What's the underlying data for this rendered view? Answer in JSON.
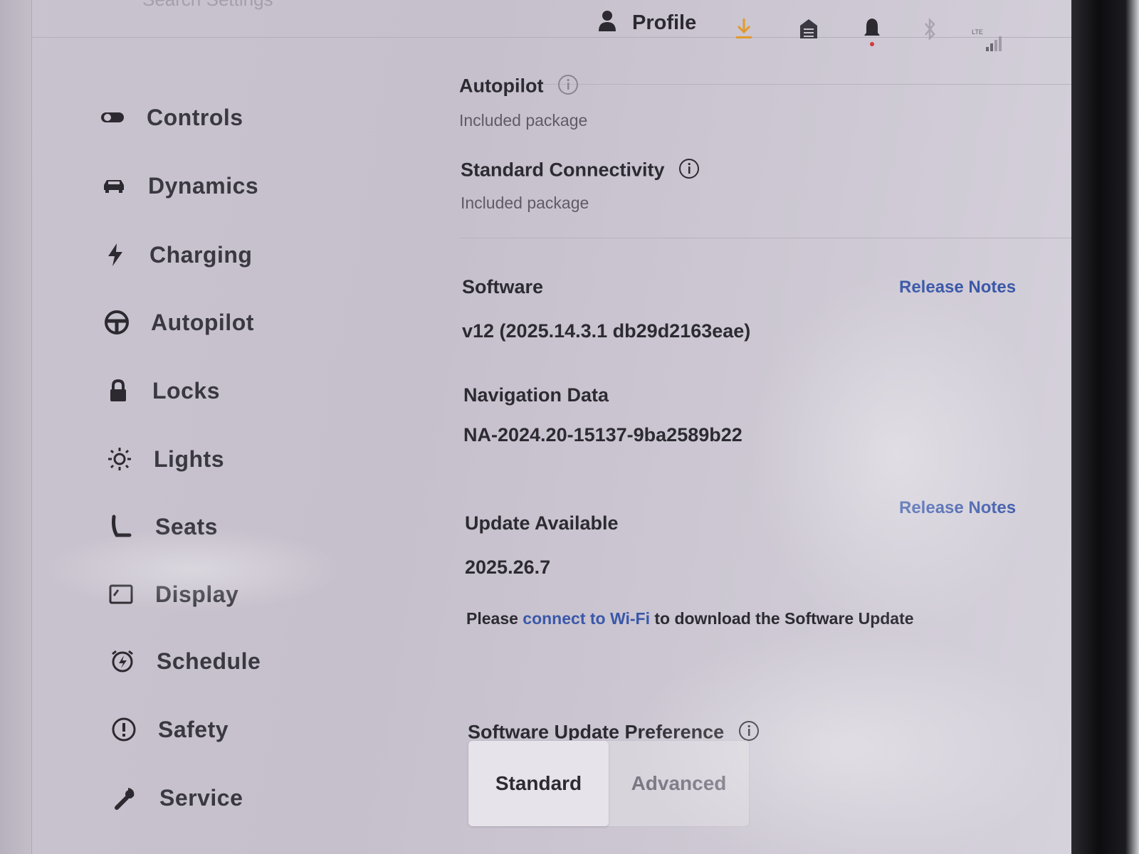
{
  "search": {
    "placeholder": "Search Settings"
  },
  "status_bar": {
    "profile_label": "Profile",
    "icons": [
      "download-icon",
      "garage-icon",
      "bell-icon",
      "bluetooth-icon",
      "lte-signal-icon"
    ],
    "lte_label": "LTE",
    "accent_color": "#e39a2b",
    "notification_dot_color": "#d23a3a"
  },
  "sidebar": {
    "items": [
      {
        "label": "Controls",
        "icon": "toggle-icon"
      },
      {
        "label": "Dynamics",
        "icon": "car-icon"
      },
      {
        "label": "Charging",
        "icon": "lightning-icon"
      },
      {
        "label": "Autopilot",
        "icon": "steering-wheel-icon"
      },
      {
        "label": "Locks",
        "icon": "lock-icon"
      },
      {
        "label": "Lights",
        "icon": "sun-icon"
      },
      {
        "label": "Seats",
        "icon": "seat-icon"
      },
      {
        "label": "Display",
        "icon": "display-icon"
      },
      {
        "label": "Schedule",
        "icon": "clock-bolt-icon"
      },
      {
        "label": "Safety",
        "icon": "alert-circle-icon"
      },
      {
        "label": "Service",
        "icon": "wrench-icon"
      }
    ]
  },
  "content": {
    "autopilot": {
      "title": "Autopilot",
      "subtitle": "Included package"
    },
    "connectivity": {
      "title": "Standard Connectivity",
      "subtitle": "Included package"
    },
    "software": {
      "title": "Software",
      "link": "Release Notes",
      "version": "v12 (2025.14.3.1 db29d2163eae)"
    },
    "navigation": {
      "title": "Navigation Data",
      "value": "NA-2024.20-15137-9ba2589b22"
    },
    "update": {
      "title": "Update Available",
      "link": "Release Notes",
      "version": "2025.26.7",
      "note_prefix": "Please ",
      "note_link": "connect to Wi-Fi",
      "note_suffix": " to download the Software Update"
    },
    "preference": {
      "title": "Software Update Preference",
      "options": [
        "Standard",
        "Advanced"
      ],
      "selected": "Standard"
    }
  },
  "colors": {
    "link": "#3a58a8",
    "text": "#2d2b32",
    "background": "#c9c3cf"
  }
}
